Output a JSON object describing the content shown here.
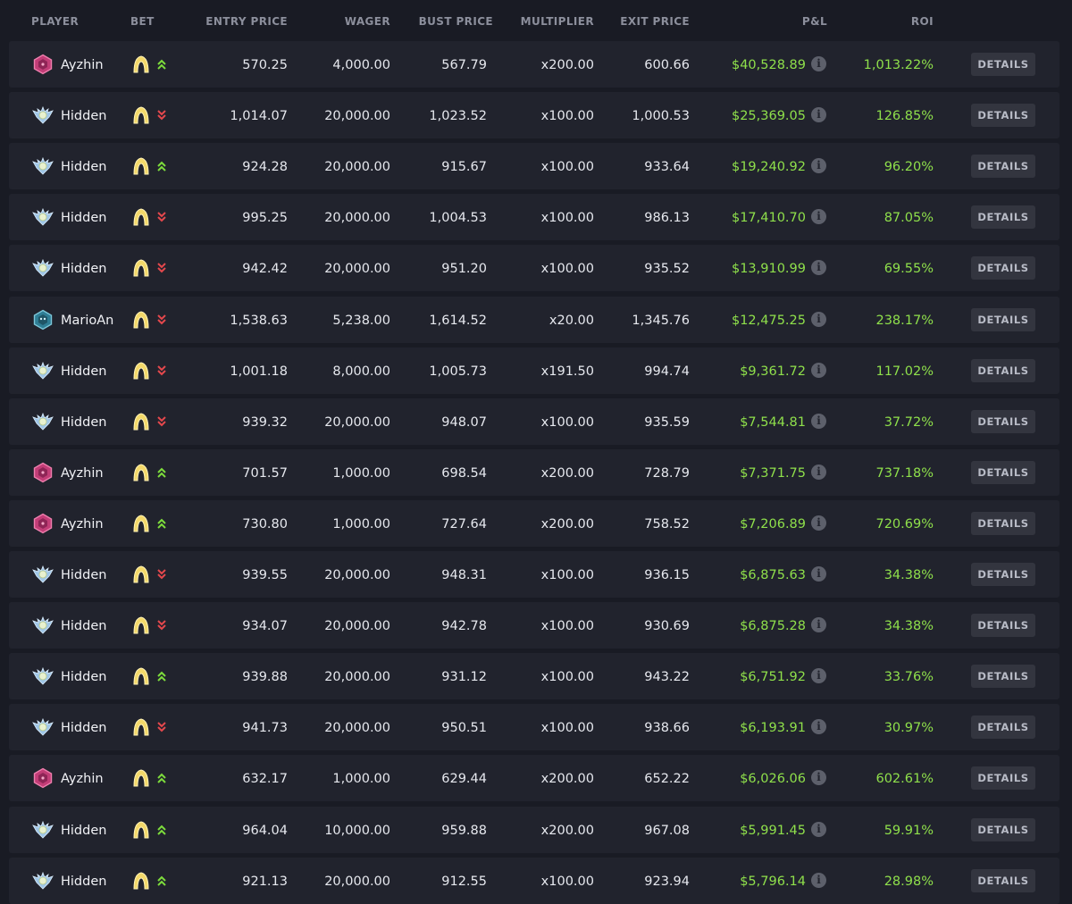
{
  "header": {
    "player": "PLAYER",
    "bet": "BET",
    "entry_price": "ENTRY PRICE",
    "wager": "WAGER",
    "bust_price": "BUST PRICE",
    "multiplier": "MULTIPLIER",
    "exit_price": "EXIT PRICE",
    "pnl": "P&L",
    "roi": "ROI"
  },
  "details_label": "DETAILS",
  "info_glyph": "i",
  "colors": {
    "background": "#191b24",
    "row": "#21232d",
    "profit_green": "#8fe04b",
    "up_arrow": "#7ddc3c",
    "down_arrow": "#e5484d",
    "bet_icon": "#f2d76b"
  },
  "icons": {
    "avatar_ayzhin": "pink-hexagon-icon",
    "avatar_hidden": "winged-badge-icon",
    "avatar_marioan": "teal-hexagon-icon",
    "bet": "rocket-bet-icon",
    "up": "double-chevron-up-icon",
    "down": "double-chevron-down-icon",
    "info": "info-icon"
  },
  "rows": [
    {
      "player": "Ayzhin",
      "avatar": "ayzhin",
      "direction": "up",
      "entry": "570.25",
      "wager": "4,000.00",
      "bust": "567.79",
      "multiplier": "x200.00",
      "exit": "600.66",
      "pnl": "$40,528.89",
      "roi": "1,013.22%"
    },
    {
      "player": "Hidden",
      "avatar": "hidden",
      "direction": "down",
      "entry": "1,014.07",
      "wager": "20,000.00",
      "bust": "1,023.52",
      "multiplier": "x100.00",
      "exit": "1,000.53",
      "pnl": "$25,369.05",
      "roi": "126.85%"
    },
    {
      "player": "Hidden",
      "avatar": "hidden",
      "direction": "up",
      "entry": "924.28",
      "wager": "20,000.00",
      "bust": "915.67",
      "multiplier": "x100.00",
      "exit": "933.64",
      "pnl": "$19,240.92",
      "roi": "96.20%"
    },
    {
      "player": "Hidden",
      "avatar": "hidden",
      "direction": "down",
      "entry": "995.25",
      "wager": "20,000.00",
      "bust": "1,004.53",
      "multiplier": "x100.00",
      "exit": "986.13",
      "pnl": "$17,410.70",
      "roi": "87.05%"
    },
    {
      "player": "Hidden",
      "avatar": "hidden",
      "direction": "down",
      "entry": "942.42",
      "wager": "20,000.00",
      "bust": "951.20",
      "multiplier": "x100.00",
      "exit": "935.52",
      "pnl": "$13,910.99",
      "roi": "69.55%"
    },
    {
      "player": "MarioAn",
      "avatar": "marioan",
      "direction": "down",
      "entry": "1,538.63",
      "wager": "5,238.00",
      "bust": "1,614.52",
      "multiplier": "x20.00",
      "exit": "1,345.76",
      "pnl": "$12,475.25",
      "roi": "238.17%"
    },
    {
      "player": "Hidden",
      "avatar": "hidden",
      "direction": "down",
      "entry": "1,001.18",
      "wager": "8,000.00",
      "bust": "1,005.73",
      "multiplier": "x191.50",
      "exit": "994.74",
      "pnl": "$9,361.72",
      "roi": "117.02%"
    },
    {
      "player": "Hidden",
      "avatar": "hidden",
      "direction": "down",
      "entry": "939.32",
      "wager": "20,000.00",
      "bust": "948.07",
      "multiplier": "x100.00",
      "exit": "935.59",
      "pnl": "$7,544.81",
      "roi": "37.72%"
    },
    {
      "player": "Ayzhin",
      "avatar": "ayzhin",
      "direction": "up",
      "entry": "701.57",
      "wager": "1,000.00",
      "bust": "698.54",
      "multiplier": "x200.00",
      "exit": "728.79",
      "pnl": "$7,371.75",
      "roi": "737.18%"
    },
    {
      "player": "Ayzhin",
      "avatar": "ayzhin",
      "direction": "up",
      "entry": "730.80",
      "wager": "1,000.00",
      "bust": "727.64",
      "multiplier": "x200.00",
      "exit": "758.52",
      "pnl": "$7,206.89",
      "roi": "720.69%"
    },
    {
      "player": "Hidden",
      "avatar": "hidden",
      "direction": "down",
      "entry": "939.55",
      "wager": "20,000.00",
      "bust": "948.31",
      "multiplier": "x100.00",
      "exit": "936.15",
      "pnl": "$6,875.63",
      "roi": "34.38%"
    },
    {
      "player": "Hidden",
      "avatar": "hidden",
      "direction": "down",
      "entry": "934.07",
      "wager": "20,000.00",
      "bust": "942.78",
      "multiplier": "x100.00",
      "exit": "930.69",
      "pnl": "$6,875.28",
      "roi": "34.38%"
    },
    {
      "player": "Hidden",
      "avatar": "hidden",
      "direction": "up",
      "entry": "939.88",
      "wager": "20,000.00",
      "bust": "931.12",
      "multiplier": "x100.00",
      "exit": "943.22",
      "pnl": "$6,751.92",
      "roi": "33.76%"
    },
    {
      "player": "Hidden",
      "avatar": "hidden",
      "direction": "down",
      "entry": "941.73",
      "wager": "20,000.00",
      "bust": "950.51",
      "multiplier": "x100.00",
      "exit": "938.66",
      "pnl": "$6,193.91",
      "roi": "30.97%"
    },
    {
      "player": "Ayzhin",
      "avatar": "ayzhin",
      "direction": "up",
      "entry": "632.17",
      "wager": "1,000.00",
      "bust": "629.44",
      "multiplier": "x200.00",
      "exit": "652.22",
      "pnl": "$6,026.06",
      "roi": "602.61%"
    },
    {
      "player": "Hidden",
      "avatar": "hidden",
      "direction": "up",
      "entry": "964.04",
      "wager": "10,000.00",
      "bust": "959.88",
      "multiplier": "x200.00",
      "exit": "967.08",
      "pnl": "$5,991.45",
      "roi": "59.91%"
    },
    {
      "player": "Hidden",
      "avatar": "hidden",
      "direction": "up",
      "entry": "921.13",
      "wager": "20,000.00",
      "bust": "912.55",
      "multiplier": "x100.00",
      "exit": "923.94",
      "pnl": "$5,796.14",
      "roi": "28.98%"
    }
  ]
}
